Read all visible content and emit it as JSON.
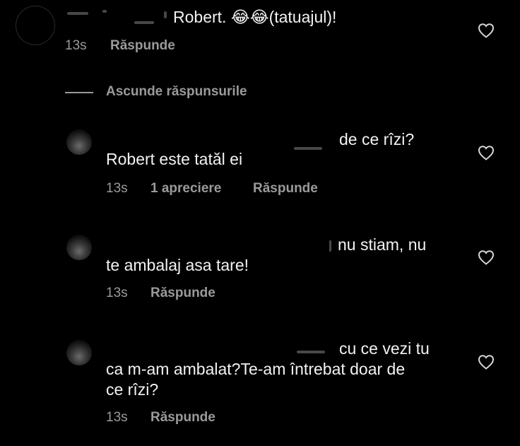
{
  "comment": {
    "text": "Robert. 😂😂(tatuajul)!",
    "time": "13s",
    "reply_label": "Răspunde"
  },
  "hide_replies_label": "Ascunde răspunsurile",
  "replies": [
    {
      "line1": "de ce rîzi?",
      "line2": "Robert este tatăl ei",
      "time": "13s",
      "likes": "1 apreciere",
      "reply_label": "Răspunde"
    },
    {
      "line1": "nu stiam, nu",
      "line2": "te ambalaj asa tare!",
      "time": "13s",
      "reply_label": "Răspunde"
    },
    {
      "line1": "cu ce vezi tu",
      "line2": "ca m-am ambalat?Te-am întrebat doar de",
      "line3": "ce rîzi?",
      "time": "13s",
      "reply_label": "Răspunde"
    }
  ],
  "icons": {
    "like": "heart-outline-icon",
    "avatar": "profile-avatar"
  },
  "colors": {
    "background": "#000000",
    "text": "#f2f2f2",
    "meta": "#9a9a9a"
  }
}
